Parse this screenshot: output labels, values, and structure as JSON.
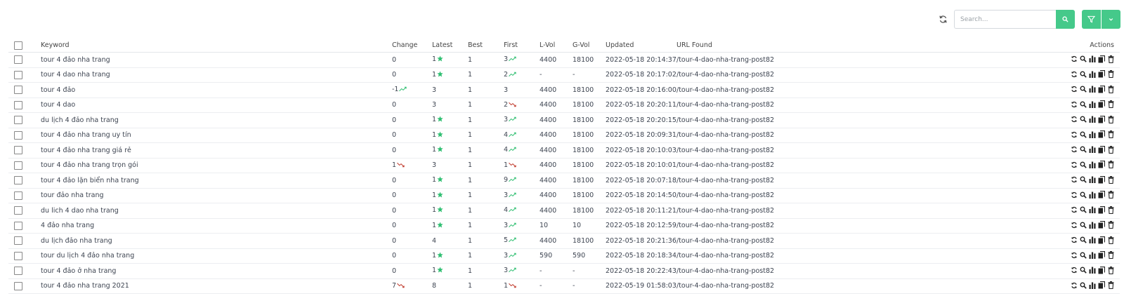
{
  "search": {
    "placeholder": "Search..."
  },
  "colors": {
    "accent": "#45c98a",
    "up": "#2fbf71",
    "down": "#c0392b"
  },
  "table": {
    "headers": {
      "keyword": "Keyword",
      "change": "Change",
      "latest": "Latest",
      "best": "Best",
      "first": "First",
      "lvol": "L-Vol",
      "gvol": "G-Vol",
      "updated": "Updated",
      "url": "URL Found",
      "actions": "Actions"
    },
    "rows": [
      {
        "keyword": "tour 4 đảo nha trang",
        "change": "0",
        "change_trend": "",
        "latest": "1",
        "latest_star": true,
        "best": "1",
        "first": "3",
        "first_trend": "up",
        "lvol": "4400",
        "gvol": "18100",
        "updated": "2022-05-18 20:14:37",
        "url": "/tour-4-dao-nha-trang-post82"
      },
      {
        "keyword": "tour 4 dao nha trang",
        "change": "0",
        "change_trend": "",
        "latest": "1",
        "latest_star": true,
        "best": "1",
        "first": "2",
        "first_trend": "up",
        "lvol": "-",
        "gvol": "-",
        "updated": "2022-05-18 20:17:02",
        "url": "/tour-4-dao-nha-trang-post82"
      },
      {
        "keyword": "tour 4 đảo",
        "change": "-1",
        "change_trend": "up",
        "latest": "3",
        "latest_star": false,
        "best": "1",
        "first": "3",
        "first_trend": "",
        "lvol": "4400",
        "gvol": "18100",
        "updated": "2022-05-18 20:16:00",
        "url": "/tour-4-dao-nha-trang-post82"
      },
      {
        "keyword": "tour 4 dao",
        "change": "0",
        "change_trend": "",
        "latest": "3",
        "latest_star": false,
        "best": "1",
        "first": "2",
        "first_trend": "down",
        "lvol": "4400",
        "gvol": "18100",
        "updated": "2022-05-18 20:20:11",
        "url": "/tour-4-dao-nha-trang-post82"
      },
      {
        "keyword": "du lịch 4 đảo nha trang",
        "change": "0",
        "change_trend": "",
        "latest": "1",
        "latest_star": true,
        "best": "1",
        "first": "3",
        "first_trend": "up",
        "lvol": "4400",
        "gvol": "18100",
        "updated": "2022-05-18 20:20:15",
        "url": "/tour-4-dao-nha-trang-post82"
      },
      {
        "keyword": "tour 4 đảo nha trang uy tín",
        "change": "0",
        "change_trend": "",
        "latest": "1",
        "latest_star": true,
        "best": "1",
        "first": "4",
        "first_trend": "up",
        "lvol": "4400",
        "gvol": "18100",
        "updated": "2022-05-18 20:09:31",
        "url": "/tour-4-dao-nha-trang-post82"
      },
      {
        "keyword": "tour 4 đảo nha trang giá rẻ",
        "change": "0",
        "change_trend": "",
        "latest": "1",
        "latest_star": true,
        "best": "1",
        "first": "4",
        "first_trend": "up",
        "lvol": "4400",
        "gvol": "18100",
        "updated": "2022-05-18 20:10:03",
        "url": "/tour-4-dao-nha-trang-post82"
      },
      {
        "keyword": "tour 4 đảo nha trang trọn gói",
        "change": "1",
        "change_trend": "down",
        "latest": "3",
        "latest_star": false,
        "best": "1",
        "first": "1",
        "first_trend": "down",
        "lvol": "4400",
        "gvol": "18100",
        "updated": "2022-05-18 20:10:01",
        "url": "/tour-4-dao-nha-trang-post82"
      },
      {
        "keyword": "tour 4 đảo lặn biển nha trang",
        "change": "0",
        "change_trend": "",
        "latest": "1",
        "latest_star": true,
        "best": "1",
        "first": "9",
        "first_trend": "up",
        "lvol": "4400",
        "gvol": "18100",
        "updated": "2022-05-18 20:07:18",
        "url": "/tour-4-dao-nha-trang-post82"
      },
      {
        "keyword": "tour đảo nha trang",
        "change": "0",
        "change_trend": "",
        "latest": "1",
        "latest_star": true,
        "best": "1",
        "first": "3",
        "first_trend": "up",
        "lvol": "4400",
        "gvol": "18100",
        "updated": "2022-05-18 20:14:50",
        "url": "/tour-4-dao-nha-trang-post82"
      },
      {
        "keyword": "du lich 4 dao nha trang",
        "change": "0",
        "change_trend": "",
        "latest": "1",
        "latest_star": true,
        "best": "1",
        "first": "4",
        "first_trend": "up",
        "lvol": "4400",
        "gvol": "18100",
        "updated": "2022-05-18 20:11:21",
        "url": "/tour-4-dao-nha-trang-post82"
      },
      {
        "keyword": "4 đảo nha trang",
        "change": "0",
        "change_trend": "",
        "latest": "1",
        "latest_star": true,
        "best": "1",
        "first": "3",
        "first_trend": "up",
        "lvol": "10",
        "gvol": "10",
        "updated": "2022-05-18 20:12:59",
        "url": "/tour-4-dao-nha-trang-post82"
      },
      {
        "keyword": "du lịch đảo nha trang",
        "change": "0",
        "change_trend": "",
        "latest": "4",
        "latest_star": false,
        "best": "1",
        "first": "5",
        "first_trend": "up",
        "lvol": "4400",
        "gvol": "18100",
        "updated": "2022-05-18 20:21:36",
        "url": "/tour-4-dao-nha-trang-post82"
      },
      {
        "keyword": "tour du lịch 4 đảo nha trang",
        "change": "0",
        "change_trend": "",
        "latest": "1",
        "latest_star": true,
        "best": "1",
        "first": "3",
        "first_trend": "up",
        "lvol": "590",
        "gvol": "590",
        "updated": "2022-05-18 20:18:34",
        "url": "/tour-4-dao-nha-trang-post82"
      },
      {
        "keyword": "tour 4 đảo ở nha trang",
        "change": "0",
        "change_trend": "",
        "latest": "1",
        "latest_star": true,
        "best": "1",
        "first": "3",
        "first_trend": "up",
        "lvol": "-",
        "gvol": "-",
        "updated": "2022-05-18 20:22:43",
        "url": "/tour-4-dao-nha-trang-post82"
      },
      {
        "keyword": "tour 4 đảo nha trang 2021",
        "change": "7",
        "change_trend": "down",
        "latest": "8",
        "latest_star": false,
        "best": "1",
        "first": "1",
        "first_trend": "down",
        "lvol": "-",
        "gvol": "-",
        "updated": "2022-05-19 01:58:03",
        "url": "/tour-4-dao-nha-trang-post82"
      }
    ],
    "row_actions": [
      "refresh-icon",
      "search-icon",
      "chart-icon",
      "copy-icon",
      "delete-icon"
    ]
  }
}
